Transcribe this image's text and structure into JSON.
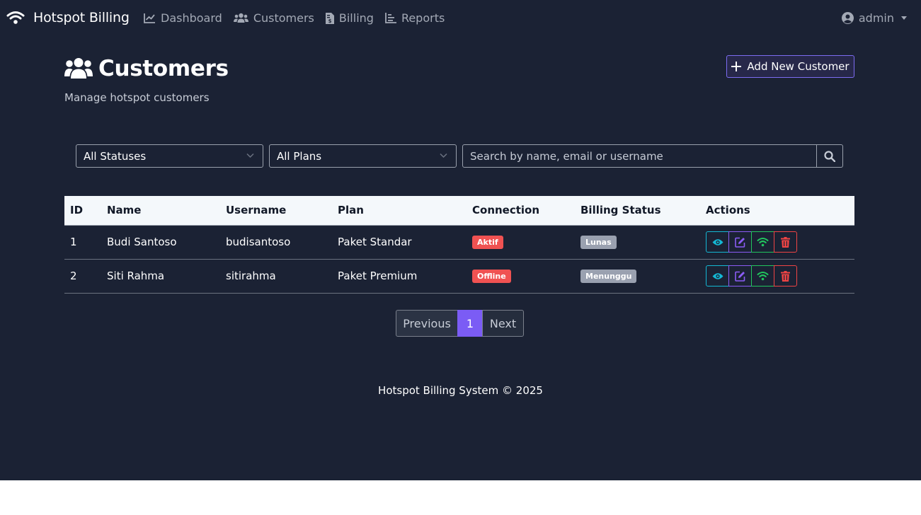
{
  "navbar": {
    "brand": "Hotspot Billing",
    "links": [
      {
        "label": "Dashboard",
        "icon": "chart-line-icon"
      },
      {
        "label": "Customers",
        "icon": "users-icon"
      },
      {
        "label": "Billing",
        "icon": "invoice-icon"
      },
      {
        "label": "Reports",
        "icon": "bar-chart-icon"
      }
    ],
    "user": "admin"
  },
  "header": {
    "title": "Customers",
    "subtitle": "Manage hotspot customers",
    "add_button": "Add New Customer"
  },
  "filters": {
    "status_selected": "All Statuses",
    "plan_selected": "All Plans",
    "search_placeholder": "Search by name, email or username",
    "search_value": ""
  },
  "table": {
    "columns": [
      "ID",
      "Name",
      "Username",
      "Plan",
      "Connection",
      "Billing Status",
      "Actions"
    ],
    "rows": [
      {
        "id": "1",
        "name": "Budi Santoso",
        "username": "budisantoso",
        "plan": "Paket Standar",
        "connection": "Aktif",
        "billing": "Lunas"
      },
      {
        "id": "2",
        "name": "Siti Rahma",
        "username": "sitirahma",
        "plan": "Paket Premium",
        "connection": "Offline",
        "billing": "Menunggu"
      }
    ]
  },
  "pagination": {
    "previous": "Previous",
    "current": "1",
    "next": "Next"
  },
  "footer": "Hotspot Billing System © 2025",
  "colors": {
    "background": "#1b2234",
    "accent": "#7b5cf5",
    "danger": "#f05252",
    "success": "#22c55e",
    "info": "#14b8d4"
  }
}
